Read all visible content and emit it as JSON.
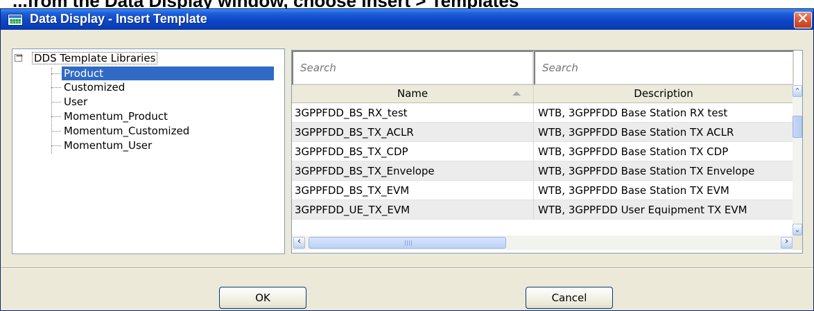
{
  "window": {
    "title": "Data Display - Insert Template",
    "close_glyph": "✕",
    "cropped_caption": "...from the Data Display window, choose Insert > Templates"
  },
  "tree": {
    "expander_glyph": "−",
    "root_label": "DDS Template Libraries",
    "items": [
      {
        "label": "Product",
        "selected": true
      },
      {
        "label": "Customized"
      },
      {
        "label": "User"
      },
      {
        "label": "Momentum_Product"
      },
      {
        "label": "Momentum_Customized"
      },
      {
        "label": "Momentum_User"
      }
    ]
  },
  "table": {
    "search": {
      "name_placeholder": "Search",
      "desc_placeholder": "Search"
    },
    "columns": {
      "name": "Name",
      "description": "Description"
    },
    "rows": [
      {
        "name": "3GPPFDD_BS_RX_test",
        "description": "WTB, 3GPPFDD Base Station RX test"
      },
      {
        "name": "3GPPFDD_BS_TX_ACLR",
        "description": "WTB, 3GPPFDD Base Station TX ACLR"
      },
      {
        "name": "3GPPFDD_BS_TX_CDP",
        "description": "WTB, 3GPPFDD Base Station TX CDP"
      },
      {
        "name": "3GPPFDD_BS_TX_Envelope",
        "description": "WTB, 3GPPFDD Base Station TX Envelope"
      },
      {
        "name": "3GPPFDD_BS_TX_EVM",
        "description": "WTB, 3GPPFDD Base Station TX EVM"
      },
      {
        "name": "3GPPFDD_UE_TX_EVM",
        "description": "WTB, 3GPPFDD User Equipment TX EVM"
      }
    ]
  },
  "scrollbars": {
    "up_glyph": "⌃",
    "down_glyph": "⌄",
    "left_glyph": "‹",
    "right_glyph": "›",
    "horizontal_position": 0.0
  },
  "buttons": {
    "ok": "OK",
    "cancel": "Cancel"
  },
  "icons": {
    "app": "data-display-icon",
    "close": "close-icon",
    "expander": "collapse-minus-icon",
    "sort": "sort-ascending-icon"
  },
  "colors": {
    "titlebar": "#0d46c8",
    "selection": "#316ac5",
    "close_button": "#d45030",
    "dialog_face": "#ece9d8"
  }
}
